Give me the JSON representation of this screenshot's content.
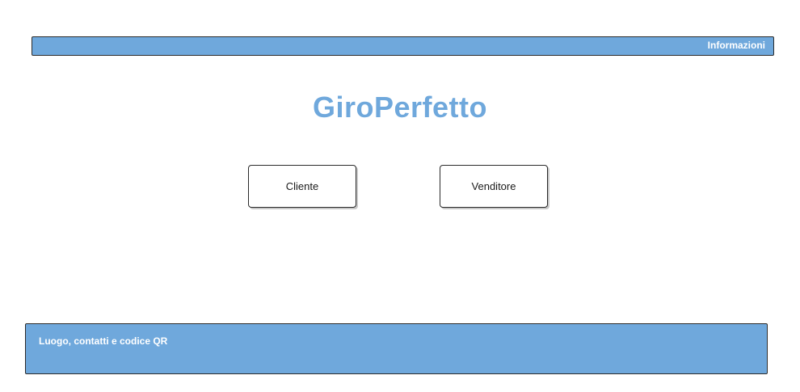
{
  "header": {
    "info_link": "Informazioni"
  },
  "main": {
    "title": "GiroPerfetto",
    "buttons": {
      "cliente": "Cliente",
      "venditore": "Venditore"
    }
  },
  "footer": {
    "text": "Luogo, contatti e codice QR"
  },
  "colors": {
    "accent": "#6fa8dc",
    "border": "#2b2b2b",
    "background": "#ffffff"
  }
}
